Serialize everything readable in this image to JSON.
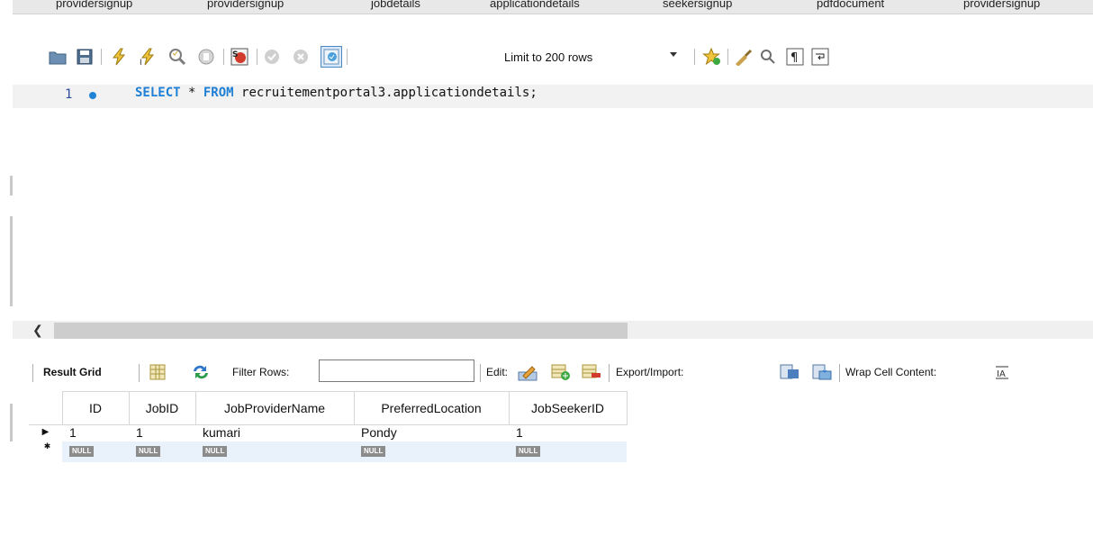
{
  "tabs": [
    "providersignup",
    "providersignup",
    "jobdetails",
    "applicationdetails",
    "seekersignup",
    "pdfdocument",
    "providersignup"
  ],
  "toolbar": {
    "limit_label": "Limit to 200 rows",
    "icons": [
      "open-folder-icon",
      "save-icon",
      "execute-icon",
      "execute-current-icon",
      "explain-icon",
      "stop-icon",
      "toggle-error-icon",
      "commit-icon",
      "rollback-icon",
      "autocommit-icon",
      "add-snippet-icon",
      "beautify-icon",
      "find-icon",
      "invisible-chars-icon",
      "word-wrap-icon"
    ]
  },
  "editor": {
    "line_number": "1",
    "sql_keyword_select": "SELECT",
    "sql_star": " * ",
    "sql_keyword_from": "FROM",
    "sql_rest": " recruitementportal3.applicationdetails;"
  },
  "result_toolbar": {
    "result_grid": "Result Grid",
    "filter_rows": "Filter Rows:",
    "filter_value": "",
    "edit": "Edit:",
    "export_import": "Export/Import:",
    "wrap_cell": "Wrap Cell Content:"
  },
  "grid": {
    "columns": [
      "ID",
      "JobID",
      "JobProviderName",
      "PreferredLocation",
      "JobSeekerID"
    ],
    "rows": [
      [
        "1",
        "1",
        "kumari",
        "Pondy",
        "1"
      ]
    ],
    "null_label": "NULL"
  }
}
